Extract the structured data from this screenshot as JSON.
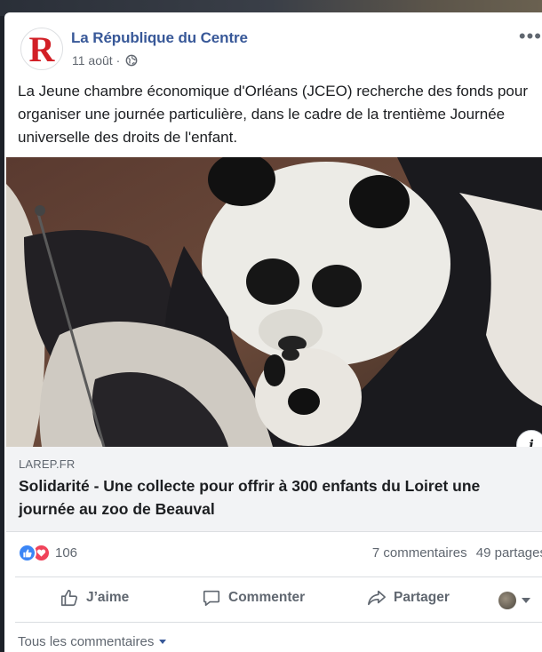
{
  "post": {
    "page_name": "La République du Centre",
    "avatar_letter": "R",
    "date": "11 août",
    "meta_sep": "·",
    "text": "La Jeune chambre économique d'Orléans (JCEO) recherche des fonds pour organiser une journée particulière, dans le cadre de la trentième Journée universelle des droits de l'enfant."
  },
  "link": {
    "domain": "LAREP.FR",
    "title": "Solidarité - Une collecte pour offrir à 300 enfants du Loiret une journée au zoo de Beauval",
    "info_label": "i"
  },
  "stats": {
    "reaction_count": "106",
    "comments": "7 commentaires",
    "shares": "49 partages"
  },
  "actions": {
    "like": "J’aime",
    "comment": "Commenter",
    "share": "Partager"
  },
  "comments_filter": "Tous les commentaires",
  "icons": {
    "globe": "globe-icon",
    "more": "more-icon",
    "like": "thumbs-up-icon",
    "comment": "comment-bubble-icon",
    "share": "share-arrow-icon"
  },
  "colors": {
    "link_blue": "#385898",
    "like_blue": "#3b86f6",
    "love_red": "#f0435a",
    "brand_red": "#d21f26"
  }
}
